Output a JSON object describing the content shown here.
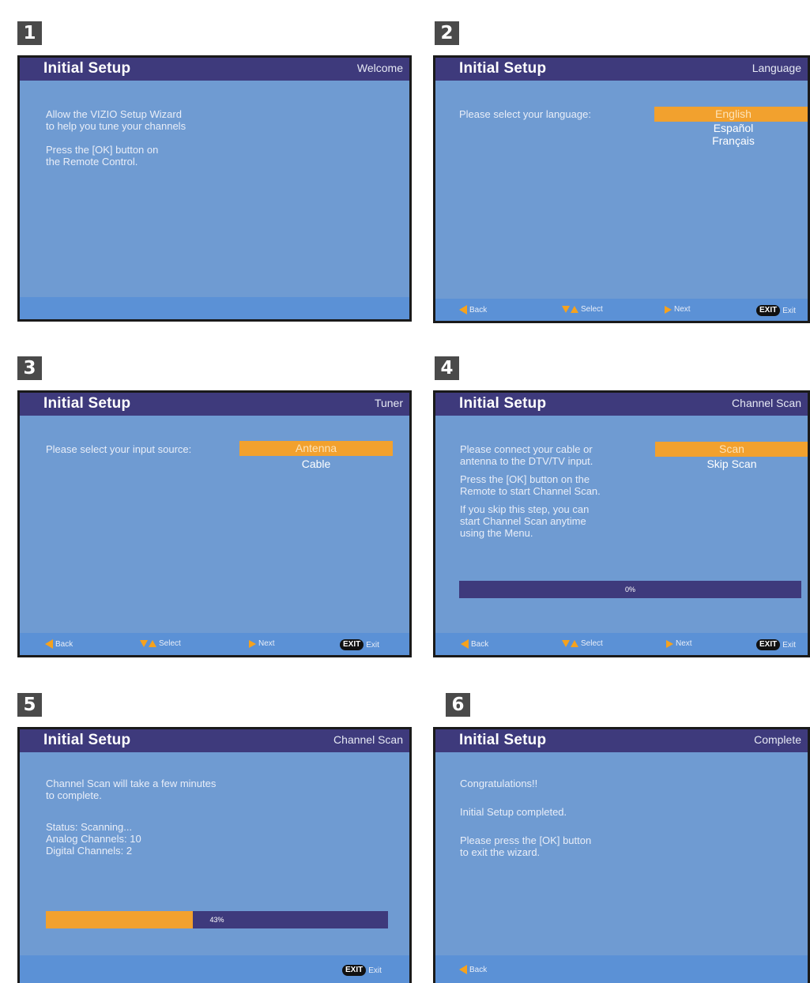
{
  "steps": [
    {
      "number": "1",
      "title": "Initial Setup",
      "subtitle": "Welcome",
      "lines": [
        "Allow the VIZIO Setup Wizard",
        "to help you tune your channels",
        "",
        "Press the [OK] button on",
        "the Remote Control."
      ]
    },
    {
      "number": "2",
      "title": "Initial Setup",
      "subtitle": "Language",
      "prompt": "Please select your language:",
      "options": [
        "English",
        "Español",
        "Français"
      ],
      "selected": "English",
      "footer": {
        "back": "Back",
        "select": "Select",
        "next": "Next",
        "exit_key": "EXIT",
        "exit": "Exit"
      }
    },
    {
      "number": "3",
      "title": "Initial Setup",
      "subtitle": "Tuner",
      "prompt": "Please select your input source:",
      "options": [
        "Antenna",
        "Cable"
      ],
      "selected": "Antenna",
      "footer": {
        "back": "Back",
        "select": "Select",
        "next": "Next",
        "exit_key": "EXIT",
        "exit": "Exit"
      }
    },
    {
      "number": "4",
      "title": "Initial Setup",
      "subtitle": "Channel Scan",
      "paragraphs": [
        [
          "Please connect your cable or",
          "antenna to the DTV/TV input."
        ],
        [
          "Press the [OK] button on the",
          "Remote to start Channel Scan."
        ],
        [
          "If you skip this step, you can",
          "start Channel Scan anytime",
          "using the Menu."
        ]
      ],
      "options": [
        "Scan",
        "Skip Scan"
      ],
      "selected": "Scan",
      "progress": {
        "percent": 0,
        "label": "0%"
      },
      "footer": {
        "back": "Back",
        "select": "Select",
        "next": "Next",
        "exit_key": "EXIT",
        "exit": "Exit"
      }
    },
    {
      "number": "5",
      "title": "Initial Setup",
      "subtitle": "Channel Scan",
      "intro": [
        "Channel Scan will take a few minutes",
        "to complete."
      ],
      "status": [
        "Status: Scanning...",
        "Analog Channels: 10",
        "Digital Channels: 2"
      ],
      "progress": {
        "percent": 43,
        "label": "43%"
      },
      "footer": {
        "exit_key": "EXIT",
        "exit": "Exit"
      }
    },
    {
      "number": "6",
      "title": "Initial Setup",
      "subtitle": "Complete",
      "lines": [
        "Congratulations!!",
        "Initial Setup completed.",
        "Please press the [OK] button",
        "to exit the wizard."
      ],
      "footer": {
        "back": "Back"
      }
    }
  ],
  "colors": {
    "panel": "#6f9bd2",
    "titlebar": "#3e3a7c",
    "highlight": "#f2a12e",
    "footer": "#5b91d6"
  },
  "icons": {
    "back": "left-arrow-icon",
    "select": "up-down-arrows-icon",
    "next": "right-arrow-icon"
  }
}
